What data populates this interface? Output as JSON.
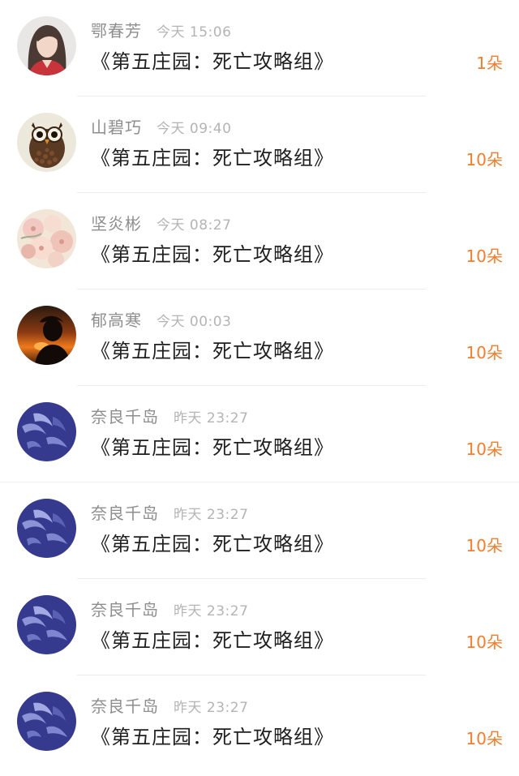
{
  "items": [
    {
      "avatar": "woman-portrait-avatar",
      "name": "鄂春芳",
      "time": "今天 15:06",
      "title": "《第五庄园：死亡攻略组》",
      "count": "1朵"
    },
    {
      "avatar": "owl-avatar",
      "name": "山碧巧",
      "time": "今天 09:40",
      "title": "《第五庄园：死亡攻略组》",
      "count": "10朵"
    },
    {
      "avatar": "flowers-avatar",
      "name": "坚炎彬",
      "time": "今天 08:27",
      "title": "《第五庄园：死亡攻略组》",
      "count": "10朵"
    },
    {
      "avatar": "sunset-silhouette-avatar",
      "name": "郁高寒",
      "time": "今天 00:03",
      "title": "《第五庄园：死亡攻略组》",
      "count": "10朵"
    },
    {
      "avatar": "blue-art-avatar",
      "name": "奈良千岛",
      "time": "昨天 23:27",
      "title": "《第五庄园：死亡攻略组》",
      "count": "10朵"
    },
    {
      "avatar": "blue-art-avatar",
      "name": "奈良千岛",
      "time": "昨天 23:27",
      "title": "《第五庄园：死亡攻略组》",
      "count": "10朵"
    },
    {
      "avatar": "blue-art-avatar",
      "name": "奈良千岛",
      "time": "昨天 23:27",
      "title": "《第五庄园：死亡攻略组》",
      "count": "10朵"
    },
    {
      "avatar": "blue-art-avatar",
      "name": "奈良千岛",
      "time": "昨天 23:27",
      "title": "《第五庄园：死亡攻略组》",
      "count": "10朵"
    }
  ],
  "colors": {
    "count": "#f07e2e",
    "name": "#8e8e8e",
    "time": "#b4b4b4",
    "title": "#1f1f1f"
  }
}
